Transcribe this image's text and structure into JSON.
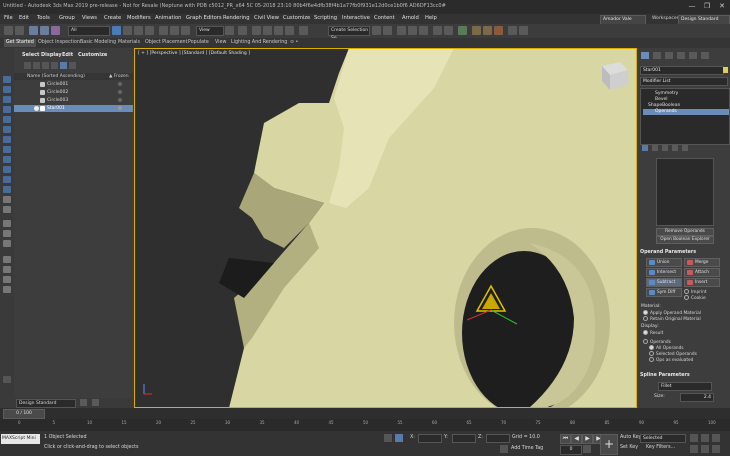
{
  "window": {
    "title": "Untitled - Autodesk 3ds Max 2019 pre-release - Not for Resale (Neptune with PDB c5012_PR_x64 5C 05-2018 23:10 80b4f6e4dfb38f4b1a77fb0f931e12d0ce1b0f6 AD6DF13cc0#",
    "minimize": "—",
    "maximize": "❐",
    "close": "✕"
  },
  "menu": {
    "items": [
      "File",
      "Edit",
      "Tools",
      "Group",
      "Views",
      "Create",
      "Modifiers",
      "Animation",
      "Graph Editors",
      "Rendering",
      "Civil View",
      "Customize",
      "Scripting",
      "Interactive",
      "Content",
      "Arnold",
      "Help"
    ],
    "user": "Amador Vale",
    "workspaces_label": "Workspaces:",
    "workspace_value": "Design Standard"
  },
  "toolbar": {
    "selection_filter": "All",
    "view": "View",
    "named_set": "Create Selection Se"
  },
  "ribbon": {
    "tabs": [
      "Get Started",
      "Object Inspection",
      "Basic Modeling",
      "Materials",
      "Object Placement",
      "Populate",
      "View",
      "Lighting And Rendering",
      "⊙ •"
    ]
  },
  "scene_explorer": {
    "tabs": [
      "Select",
      "Display",
      "Edit",
      "Customize"
    ],
    "header_name": "Name (Sorted Ascending)",
    "header_frozen": "▲ Frozen",
    "rows": [
      "Circle001",
      "Circle002",
      "Circle003",
      "Star001"
    ]
  },
  "viewport": {
    "label": "[ + ] [Perspective ] [Standard ] [Default Shading ]"
  },
  "command_panel": {
    "object_name": "Star001",
    "modifier_list": "Modifier List",
    "stack": [
      "Symmetry",
      "Bevel",
      "ShapeBoolean",
      "Operands"
    ],
    "remove_operands": "Remove Operands",
    "open_explorer": "Open Boolean Explorer",
    "operand_params_title": "Operand Parameters",
    "ops": [
      "Union",
      "Merge",
      "Intersect",
      "Attach",
      "Subtract",
      "Insert",
      "Sym Diff",
      "Imprint",
      "Cookie"
    ],
    "material_label": "Material:",
    "material_opts": [
      "Apply Operand Material",
      "Retain Original Material"
    ],
    "display_label": "Display:",
    "display_opts": [
      "Result",
      "Operands",
      "All Operands",
      "Selected Operands",
      "Ops as evaluated"
    ],
    "spline_params_title": "Spline Parameters",
    "fillet_label": "Fillet",
    "size_label": "Size:",
    "size_value": "2.4"
  },
  "bottom": {
    "workspace": "Design Standard",
    "frame": "0 / 100",
    "ticks": [
      "0",
      "5",
      "10",
      "15",
      "20",
      "25",
      "30",
      "35",
      "40",
      "45",
      "50",
      "55",
      "60",
      "65",
      "70",
      "75",
      "80",
      "85",
      "90",
      "95",
      "100"
    ],
    "maxscript": "MAXScript Mini",
    "status1": "1 Object Selected",
    "status2": "Click or click-and-drag to select objects",
    "x_label": "X:",
    "y_label": "Y:",
    "z_label": "Z:",
    "grid": "Grid = 10.0",
    "add_time_tag": "Add Time Tag",
    "auto_key": "Auto Key",
    "set_key": "Set Key",
    "selected": "Selected",
    "key_filters": "Key Filters...",
    "frame_num": "0"
  }
}
